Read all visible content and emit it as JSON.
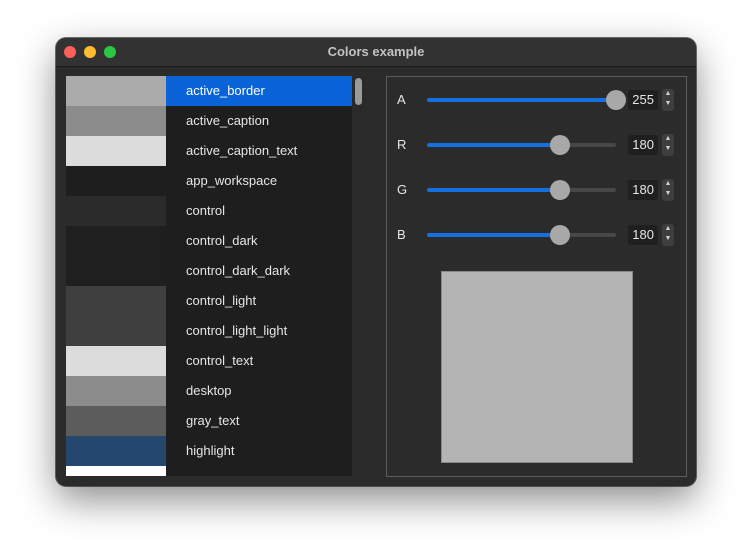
{
  "window": {
    "title": "Colors example"
  },
  "color_list": {
    "selected_index": 0,
    "items": [
      {
        "label": "active_border",
        "swatch": "#ababab"
      },
      {
        "label": "active_caption",
        "swatch": "#8c8c8c"
      },
      {
        "label": "active_caption_text",
        "swatch": "#dcdcdc"
      },
      {
        "label": "app_workspace",
        "swatch": "#1e1e1e"
      },
      {
        "label": "control",
        "swatch": "#2b2b2b"
      },
      {
        "label": "control_dark",
        "swatch": "#1f1f1f"
      },
      {
        "label": "control_dark_dark",
        "swatch": "#1f1f1f"
      },
      {
        "label": "control_light",
        "swatch": "#3f3f3f"
      },
      {
        "label": "control_light_light",
        "swatch": "#3f3f3f"
      },
      {
        "label": "control_text",
        "swatch": "#dcdcdc"
      },
      {
        "label": "desktop",
        "swatch": "#8c8c8c"
      },
      {
        "label": "gray_text",
        "swatch": "#5c5c5c"
      },
      {
        "label": "highlight",
        "swatch": "#23476d"
      },
      {
        "label": "",
        "swatch": "#ffffff"
      }
    ]
  },
  "sliders": [
    {
      "label": "A",
      "value": "255",
      "fraction": 1.0
    },
    {
      "label": "R",
      "value": "180",
      "fraction": 0.706
    },
    {
      "label": "G",
      "value": "180",
      "fraction": 0.706
    },
    {
      "label": "B",
      "value": "180",
      "fraction": 0.706
    }
  ],
  "preview_color": "#b4b4b4"
}
